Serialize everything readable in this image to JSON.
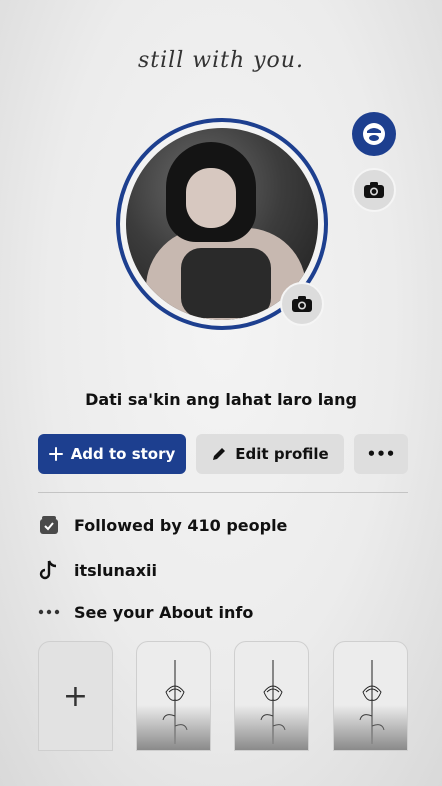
{
  "cover": {
    "title": "still with you."
  },
  "profile": {
    "bio": "Dati sa'kin ang lahat laro lang",
    "accent_color": "#1d3f8f"
  },
  "actions": {
    "add_story": "Add to story",
    "edit_profile": "Edit profile",
    "more": "•••"
  },
  "details": {
    "followed_by": "Followed by 410 people",
    "tiktok": "itslunaxii",
    "about": "See your About info"
  },
  "featured": {
    "add_symbol": "+",
    "tiles": [
      "rose-sketch",
      "rose-sketch",
      "rose-sketch"
    ]
  },
  "icons": {
    "avatar": "avatar-icon",
    "camera": "camera-icon",
    "plus": "plus-icon",
    "pencil": "pencil-icon",
    "followers": "followers-icon",
    "tiktok": "tiktok-icon",
    "more": "more-icon"
  }
}
